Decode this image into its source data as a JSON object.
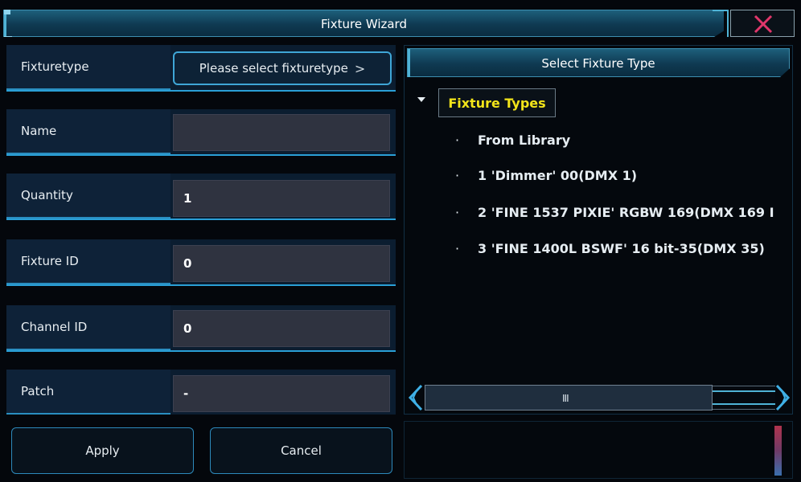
{
  "window": {
    "title": "Fixture Wizard",
    "close_icon": "close-x-icon"
  },
  "form": {
    "fixturetype": {
      "label": "Fixturetype",
      "button_text": "Please select fixturetype",
      "caret": ">"
    },
    "name": {
      "label": "Name",
      "value": ""
    },
    "quantity": {
      "label": "Quantity",
      "value": "1"
    },
    "fixture_id": {
      "label": "Fixture ID",
      "value": "0"
    },
    "channel_id": {
      "label": "Channel ID",
      "value": "0"
    },
    "patch": {
      "label": "Patch",
      "value": "-"
    }
  },
  "buttons": {
    "apply": "Apply",
    "cancel": "Cancel"
  },
  "panel": {
    "title": "Select Fixture Type",
    "tree_root": "Fixture Types",
    "items": [
      {
        "bullet": "·",
        "label": "From Library"
      },
      {
        "bullet": "·",
        "label": "1 'Dimmer' 00(DMX 1)"
      },
      {
        "bullet": "·",
        "label": "2 'FINE 1537 PIXIE' RGBW 169(DMX 169 I"
      },
      {
        "bullet": "·",
        "label": "3 'FINE 1400L BSWF' 16 bit-35(DMX 35)"
      }
    ],
    "scrollbar_grip": "III"
  },
  "colors": {
    "accent": "#2a9fd6",
    "tree_root_text": "#f2e41a",
    "close_x": "#e0366a"
  }
}
